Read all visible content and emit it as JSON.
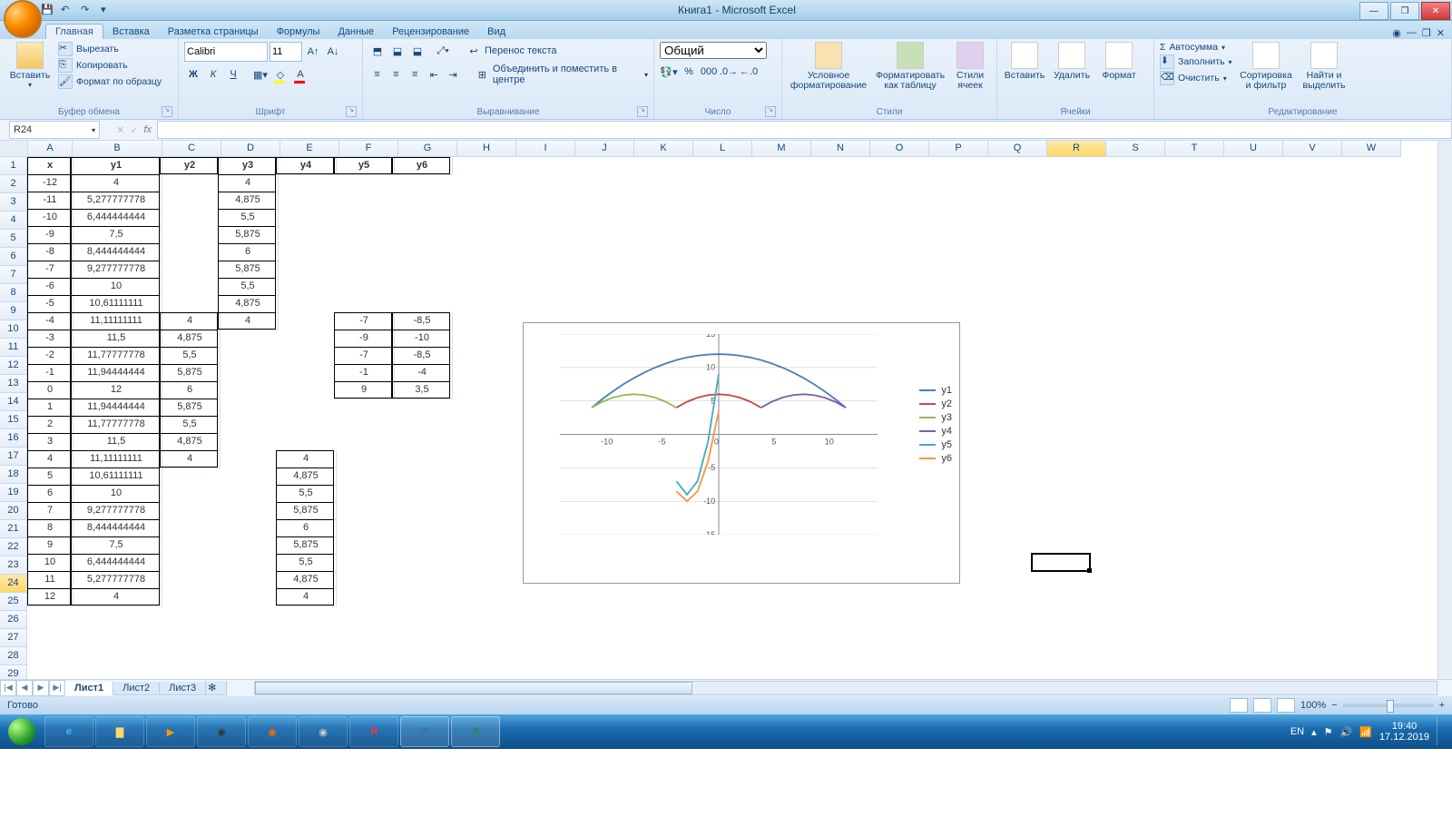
{
  "app": {
    "title": "Книга1 - Microsoft Excel"
  },
  "qat": {
    "save": "save-icon",
    "undo": "undo-icon",
    "redo": "redo-icon"
  },
  "tabs": [
    "Главная",
    "Вставка",
    "Разметка страницы",
    "Формулы",
    "Данные",
    "Рецензирование",
    "Вид"
  ],
  "active_tab": "Главная",
  "ribbon": {
    "clipboard": {
      "paste": "Вставить",
      "cut": "Вырезать",
      "copy": "Копировать",
      "brush": "Формат по образцу",
      "label": "Буфер обмена"
    },
    "font": {
      "name": "Calibri",
      "size": "11",
      "label": "Шрифт"
    },
    "align": {
      "wrap": "Перенос текста",
      "merge": "Объединить и поместить в центре",
      "label": "Выравнивание"
    },
    "number": {
      "format": "Общий",
      "label": "Число"
    },
    "styles": {
      "cond": "Условное форматирование",
      "table": "Форматировать как таблицу",
      "cell": "Стили ячеек",
      "label": "Стили"
    },
    "cells": {
      "insert": "Вставить",
      "delete": "Удалить",
      "format": "Формат",
      "label": "Ячейки"
    },
    "editing": {
      "sum": "Автосумма",
      "fill": "Заполнить",
      "clear": "Очистить",
      "sort": "Сортировка и фильтр",
      "find": "Найти и выделить",
      "label": "Редактирование"
    }
  },
  "namebox": "R24",
  "columns": [
    "A",
    "B",
    "C",
    "D",
    "E",
    "F",
    "G",
    "H",
    "I",
    "J",
    "K",
    "L",
    "M",
    "N",
    "O",
    "P",
    "Q",
    "R",
    "S",
    "T",
    "U",
    "V",
    "W"
  ],
  "selected_col": "R",
  "selected_row": 24,
  "headers": {
    "A": "x",
    "B": "y1",
    "C": "y2",
    "D": "y3",
    "E": "y4",
    "F": "y5",
    "G": "y6"
  },
  "rows": [
    {
      "r": 2,
      "A": "-12",
      "B": "4",
      "D": "4"
    },
    {
      "r": 3,
      "A": "-11",
      "B": "5,277777778",
      "D": "4,875"
    },
    {
      "r": 4,
      "A": "-10",
      "B": "6,444444444",
      "D": "5,5"
    },
    {
      "r": 5,
      "A": "-9",
      "B": "7,5",
      "D": "5,875"
    },
    {
      "r": 6,
      "A": "-8",
      "B": "8,444444444",
      "D": "6"
    },
    {
      "r": 7,
      "A": "-7",
      "B": "9,277777778",
      "D": "5,875"
    },
    {
      "r": 8,
      "A": "-6",
      "B": "10",
      "D": "5,5"
    },
    {
      "r": 9,
      "A": "-5",
      "B": "10,61111111",
      "D": "4,875"
    },
    {
      "r": 10,
      "A": "-4",
      "B": "11,11111111",
      "C": "4",
      "D": "4",
      "F": "-7",
      "G": "-8,5"
    },
    {
      "r": 11,
      "A": "-3",
      "B": "11,5",
      "C": "4,875",
      "F": "-9",
      "G": "-10"
    },
    {
      "r": 12,
      "A": "-2",
      "B": "11,77777778",
      "C": "5,5",
      "F": "-7",
      "G": "-8,5"
    },
    {
      "r": 13,
      "A": "-1",
      "B": "11,94444444",
      "C": "5,875",
      "F": "-1",
      "G": "-4"
    },
    {
      "r": 14,
      "A": "0",
      "B": "12",
      "C": "6",
      "F": "9",
      "G": "3,5"
    },
    {
      "r": 15,
      "A": "1",
      "B": "11,94444444",
      "C": "5,875"
    },
    {
      "r": 16,
      "A": "2",
      "B": "11,77777778",
      "C": "5,5"
    },
    {
      "r": 17,
      "A": "3",
      "B": "11,5",
      "C": "4,875"
    },
    {
      "r": 18,
      "A": "4",
      "B": "11,11111111",
      "C": "4",
      "E": "4"
    },
    {
      "r": 19,
      "A": "5",
      "B": "10,61111111",
      "E": "4,875"
    },
    {
      "r": 20,
      "A": "6",
      "B": "10",
      "E": "5,5"
    },
    {
      "r": 21,
      "A": "7",
      "B": "9,277777778",
      "E": "5,875"
    },
    {
      "r": 22,
      "A": "8",
      "B": "8,444444444",
      "E": "6"
    },
    {
      "r": 23,
      "A": "9",
      "B": "7,5",
      "E": "5,875"
    },
    {
      "r": 24,
      "A": "10",
      "B": "6,444444444",
      "E": "5,5"
    },
    {
      "r": 25,
      "A": "11",
      "B": "5,277777778",
      "E": "4,875"
    },
    {
      "r": 26,
      "A": "12",
      "B": "4",
      "E": "4"
    }
  ],
  "table_borders": {
    "A": [
      1,
      26
    ],
    "B": [
      1,
      26
    ],
    "C": [
      1,
      18
    ],
    "D": [
      1,
      10
    ],
    "E": [
      1,
      26,
      18
    ],
    "F": [
      1,
      14,
      10
    ],
    "G": [
      1,
      14,
      10
    ]
  },
  "chart_data": {
    "type": "line",
    "title": "",
    "xlabel": "",
    "ylabel": "",
    "xlim": [
      -15,
      15
    ],
    "ylim": [
      -15,
      15
    ],
    "xticks": [
      -15,
      -10,
      -5,
      0,
      5,
      10,
      15
    ],
    "yticks": [
      -15,
      -10,
      -5,
      0,
      5,
      10,
      15
    ],
    "series": [
      {
        "name": "y1",
        "color": "#4a7ebb",
        "x": [
          -12,
          -11,
          -10,
          -9,
          -8,
          -7,
          -6,
          -5,
          -4,
          -3,
          -2,
          -1,
          0,
          1,
          2,
          3,
          4,
          5,
          6,
          7,
          8,
          9,
          10,
          11,
          12
        ],
        "y": [
          4,
          5.28,
          6.44,
          7.5,
          8.44,
          9.28,
          10,
          10.61,
          11.11,
          11.5,
          11.78,
          11.94,
          12,
          11.94,
          11.78,
          11.5,
          11.11,
          10.61,
          10,
          9.28,
          8.44,
          7.5,
          6.44,
          5.28,
          4
        ]
      },
      {
        "name": "y2",
        "color": "#be4b48",
        "x": [
          -4,
          -3,
          -2,
          -1,
          0,
          1,
          2,
          3,
          4
        ],
        "y": [
          4,
          4.875,
          5.5,
          5.875,
          6,
          5.875,
          5.5,
          4.875,
          4
        ]
      },
      {
        "name": "y3",
        "color": "#98b954",
        "x": [
          -12,
          -11,
          -10,
          -9,
          -8,
          -7,
          -6,
          -5,
          -4
        ],
        "y": [
          4,
          4.875,
          5.5,
          5.875,
          6,
          5.875,
          5.5,
          4.875,
          4
        ]
      },
      {
        "name": "y4",
        "color": "#7d60a0",
        "x": [
          4,
          5,
          6,
          7,
          8,
          9,
          10,
          11,
          12
        ],
        "y": [
          4,
          4.875,
          5.5,
          5.875,
          6,
          5.875,
          5.5,
          4.875,
          4
        ]
      },
      {
        "name": "y5",
        "color": "#46aac5",
        "x": [
          -4,
          -3,
          -2,
          -1,
          0
        ],
        "y": [
          -7,
          -9,
          -7,
          -1,
          9
        ]
      },
      {
        "name": "y6",
        "color": "#f79646",
        "x": [
          -4,
          -3,
          -2,
          -1,
          0
        ],
        "y": [
          -8.5,
          -10,
          -8.5,
          -4,
          3.5
        ]
      }
    ],
    "legend": [
      "y1",
      "y2",
      "y3",
      "y4",
      "y5",
      "y6"
    ],
    "legend_colors": [
      "#4a7ebb",
      "#be4b48",
      "#98b954",
      "#7d60a0",
      "#46aac5",
      "#f79646"
    ]
  },
  "sheets": [
    "Лист1",
    "Лист2",
    "Лист3"
  ],
  "active_sheet": "Лист1",
  "status": "Готово",
  "zoom": "100%",
  "lang": "EN",
  "time": "19:40",
  "date": "17.12.2019"
}
